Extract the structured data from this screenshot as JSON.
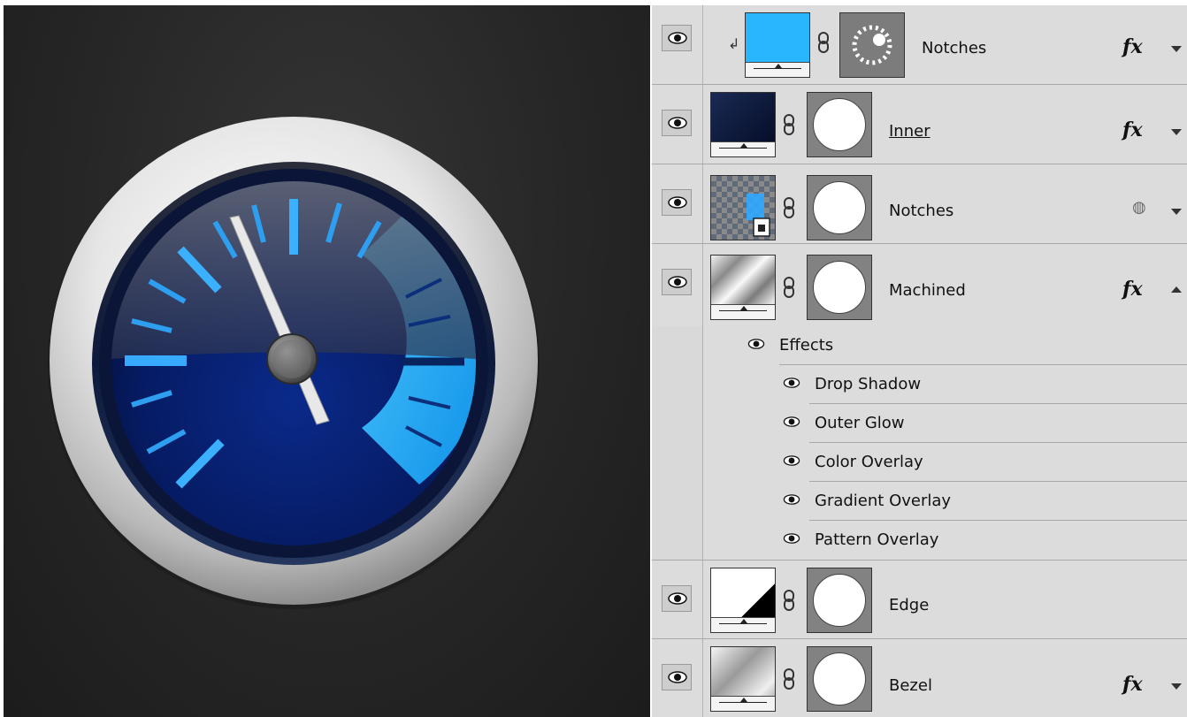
{
  "layers": [
    {
      "name": "Notches",
      "clipped": true,
      "has_fx": true,
      "underline": false,
      "expanded": false
    },
    {
      "name": "Inner",
      "clipped": false,
      "has_fx": true,
      "underline": true,
      "expanded": false
    },
    {
      "name": "Notches",
      "clipped": false,
      "has_fx": false,
      "smart_object": true,
      "underline": false,
      "expanded": false
    },
    {
      "name": "Machined",
      "clipped": false,
      "has_fx": true,
      "underline": false,
      "expanded": true
    },
    {
      "name": "Edge",
      "clipped": false,
      "has_fx": false,
      "underline": false,
      "expanded": false
    },
    {
      "name": "Bezel",
      "clipped": false,
      "has_fx": true,
      "underline": false,
      "expanded": false
    }
  ],
  "fx_label": "fx",
  "effects": {
    "header": "Effects",
    "items": [
      "Drop Shadow",
      "Outer Glow",
      "Color Overlay",
      "Gradient Overlay",
      "Pattern Overlay"
    ]
  },
  "icons": {
    "visibility": "eye-icon",
    "link": "chain-link-icon",
    "clip": "clipping-arrow-icon",
    "smart": "smart-object-icon",
    "expand": "triangle-down-icon",
    "collapse": "triangle-up-icon"
  },
  "colors": {
    "canvas_bg": "#262626",
    "panel_bg": "#dcdcdc",
    "gauge_blue": "#2fb8ff",
    "dial_dark": "#071a55"
  }
}
